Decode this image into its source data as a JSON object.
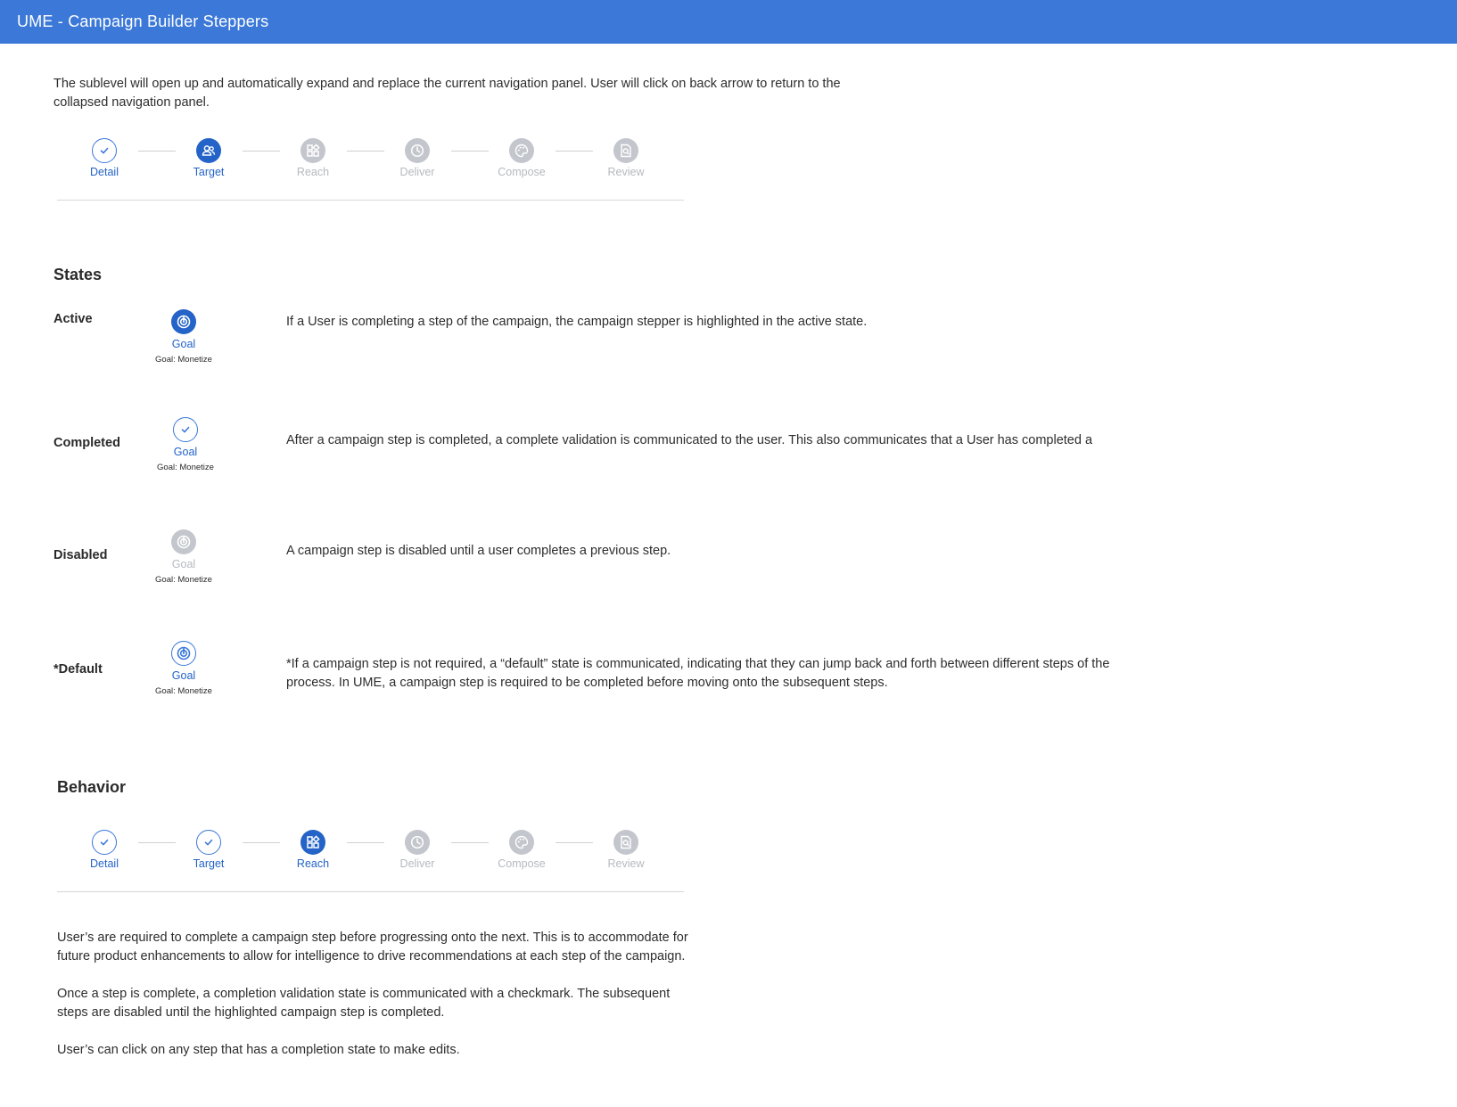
{
  "header": {
    "title": "UME - Campaign Builder Steppers"
  },
  "intro": {
    "line1": "The sublevel will open up and automatically expand and replace the current navigation panel. User will click on back arrow to return to the",
    "line2": "collapsed navigation panel."
  },
  "stepper_top": {
    "steps": [
      {
        "label": "Detail",
        "state": "completed",
        "icon": "check-icon"
      },
      {
        "label": "Target",
        "state": "active",
        "icon": "users-icon"
      },
      {
        "label": "Reach",
        "state": "disabled",
        "icon": "grid-icon"
      },
      {
        "label": "Deliver",
        "state": "disabled",
        "icon": "clock-icon"
      },
      {
        "label": "Compose",
        "state": "disabled",
        "icon": "palette-icon"
      },
      {
        "label": "Review",
        "state": "disabled",
        "icon": "review-icon"
      }
    ]
  },
  "states": {
    "heading": "States",
    "active": {
      "label": "Active",
      "step_label": "Goal",
      "sub": "Goal: Monetize",
      "description": "If a User is completing a step of the campaign, the campaign stepper is highlighted in the active state."
    },
    "completed": {
      "label": "Completed",
      "step_label": "Goal",
      "sub": "Goal: Monetize",
      "description": "After a campaign step is completed, a complete validation is communicated to the user. This also communicates that a User has completed a"
    },
    "disabled": {
      "label": "Disabled",
      "step_label": "Goal",
      "sub": "Goal: Monetize",
      "description": "A campaign step is disabled until a user completes a previous step."
    },
    "default": {
      "label": "*Default",
      "step_label": "Goal",
      "sub": "Goal: Monetize",
      "description_line1": "*If a campaign step is not required, a “default” state is communicated, indicating that they can jump back and forth between different steps of the",
      "description_line2": "process. In UME, a campaign step is required to be completed before moving onto the subsequent steps."
    }
  },
  "behavior": {
    "heading": "Behavior",
    "steps": [
      {
        "label": "Detail",
        "state": "completed",
        "icon": "check-icon"
      },
      {
        "label": "Target",
        "state": "completed",
        "icon": "check-icon"
      },
      {
        "label": "Reach",
        "state": "active",
        "icon": "grid-icon"
      },
      {
        "label": "Deliver",
        "state": "disabled",
        "icon": "clock-icon"
      },
      {
        "label": "Compose",
        "state": "disabled",
        "icon": "palette-icon"
      },
      {
        "label": "Review",
        "state": "disabled",
        "icon": "review-icon"
      }
    ],
    "p1_line1": "User’s are required to complete a campaign step before progressing onto the next. This is to accommodate for",
    "p1_line2": "future product enhancements to allow for intelligence to drive recommendations at each step of the campaign.",
    "p2_line1": "Once a step is complete, a completion validation state is communicated with a checkmark. The subsequent",
    "p2_line2": "steps are disabled until the highlighted campaign step is completed.",
    "p3": "User’s can click on any step that has a completion state to make edits."
  },
  "colors": {
    "header": "#3b78d8",
    "active": "#2463c7",
    "completed": "#3b78d8",
    "disabled": "#c3c6cc"
  }
}
